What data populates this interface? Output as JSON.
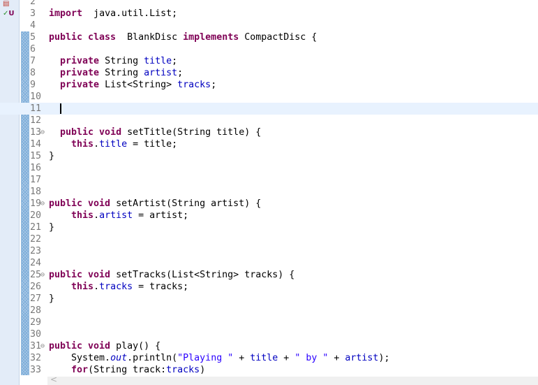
{
  "sidebar": {
    "icons": [
      "hierarchy-icon",
      "junit-icon"
    ],
    "junit_label": "U"
  },
  "editor": {
    "current_line": 11,
    "lines": [
      {
        "n": "2",
        "t": []
      },
      {
        "n": "3",
        "t": [
          [
            "kw",
            "import"
          ],
          [
            "",
            "  java.util.List;"
          ]
        ]
      },
      {
        "n": "4",
        "t": []
      },
      {
        "n": "5",
        "t": [
          [
            "kw",
            "public class"
          ],
          [
            "",
            "  BlankDisc "
          ],
          [
            "kw",
            "implements"
          ],
          [
            "",
            " CompactDisc {"
          ]
        ]
      },
      {
        "n": "6",
        "t": []
      },
      {
        "n": "7",
        "t": [
          [
            "",
            "  "
          ],
          [
            "kw",
            "private"
          ],
          [
            "",
            " String "
          ],
          [
            "fd",
            "title"
          ],
          [
            "",
            ";"
          ]
        ]
      },
      {
        "n": "8",
        "t": [
          [
            "",
            "  "
          ],
          [
            "kw",
            "private"
          ],
          [
            "",
            " String "
          ],
          [
            "fd",
            "artist"
          ],
          [
            "",
            ";"
          ]
        ]
      },
      {
        "n": "9",
        "t": [
          [
            "",
            "  "
          ],
          [
            "kw",
            "private"
          ],
          [
            "",
            " List<String> "
          ],
          [
            "fd",
            "tracks"
          ],
          [
            "",
            ";"
          ]
        ]
      },
      {
        "n": "10",
        "t": []
      },
      {
        "n": "11",
        "t": [],
        "caret": true
      },
      {
        "n": "12",
        "t": []
      },
      {
        "n": "13",
        "fold": true,
        "t": [
          [
            "",
            "  "
          ],
          [
            "kw",
            "public void"
          ],
          [
            "",
            " setTitle(String title) {"
          ]
        ]
      },
      {
        "n": "14",
        "t": [
          [
            "",
            "    "
          ],
          [
            "kw",
            "this"
          ],
          [
            "",
            "."
          ],
          [
            "fd",
            "title"
          ],
          [
            "",
            " = title;"
          ]
        ]
      },
      {
        "n": "15",
        "t": [
          [
            "",
            "}"
          ]
        ]
      },
      {
        "n": "16",
        "t": []
      },
      {
        "n": "17",
        "t": []
      },
      {
        "n": "18",
        "t": []
      },
      {
        "n": "19",
        "fold": true,
        "t": [
          [
            "kw",
            "public void"
          ],
          [
            "",
            " setArtist(String artist) {"
          ]
        ]
      },
      {
        "n": "20",
        "t": [
          [
            "",
            "    "
          ],
          [
            "kw",
            "this"
          ],
          [
            "",
            "."
          ],
          [
            "fd",
            "artist"
          ],
          [
            "",
            " = artist;"
          ]
        ]
      },
      {
        "n": "21",
        "t": [
          [
            "",
            "}"
          ]
        ]
      },
      {
        "n": "22",
        "t": []
      },
      {
        "n": "23",
        "t": []
      },
      {
        "n": "24",
        "t": []
      },
      {
        "n": "25",
        "fold": true,
        "t": [
          [
            "kw",
            "public void"
          ],
          [
            "",
            " setTracks(List<String> tracks) {"
          ]
        ]
      },
      {
        "n": "26",
        "t": [
          [
            "",
            "    "
          ],
          [
            "kw",
            "this"
          ],
          [
            "",
            "."
          ],
          [
            "fd",
            "tracks"
          ],
          [
            "",
            " = tracks;"
          ]
        ]
      },
      {
        "n": "27",
        "t": [
          [
            "",
            "}"
          ]
        ]
      },
      {
        "n": "28",
        "t": []
      },
      {
        "n": "29",
        "t": []
      },
      {
        "n": "30",
        "t": []
      },
      {
        "n": "31",
        "fold": true,
        "t": [
          [
            "kw",
            "public void"
          ],
          [
            "",
            " play() {"
          ]
        ]
      },
      {
        "n": "32",
        "t": [
          [
            "",
            "    System."
          ],
          [
            "sf",
            "out"
          ],
          [
            "",
            ".println("
          ],
          [
            "st",
            "\"Playing \""
          ],
          [
            "",
            " + "
          ],
          [
            "fd",
            "title"
          ],
          [
            "",
            " + "
          ],
          [
            "st",
            "\" by \""
          ],
          [
            "",
            " + "
          ],
          [
            "fd",
            "artist"
          ],
          [
            "",
            ");"
          ]
        ]
      },
      {
        "n": "33",
        "t": [
          [
            "",
            "    "
          ],
          [
            "kw",
            "for"
          ],
          [
            "",
            "(String track:"
          ],
          [
            "fd",
            "tracks"
          ],
          [
            "",
            ")"
          ]
        ]
      }
    ]
  },
  "scrollbar": {
    "left_arrow": "<"
  }
}
